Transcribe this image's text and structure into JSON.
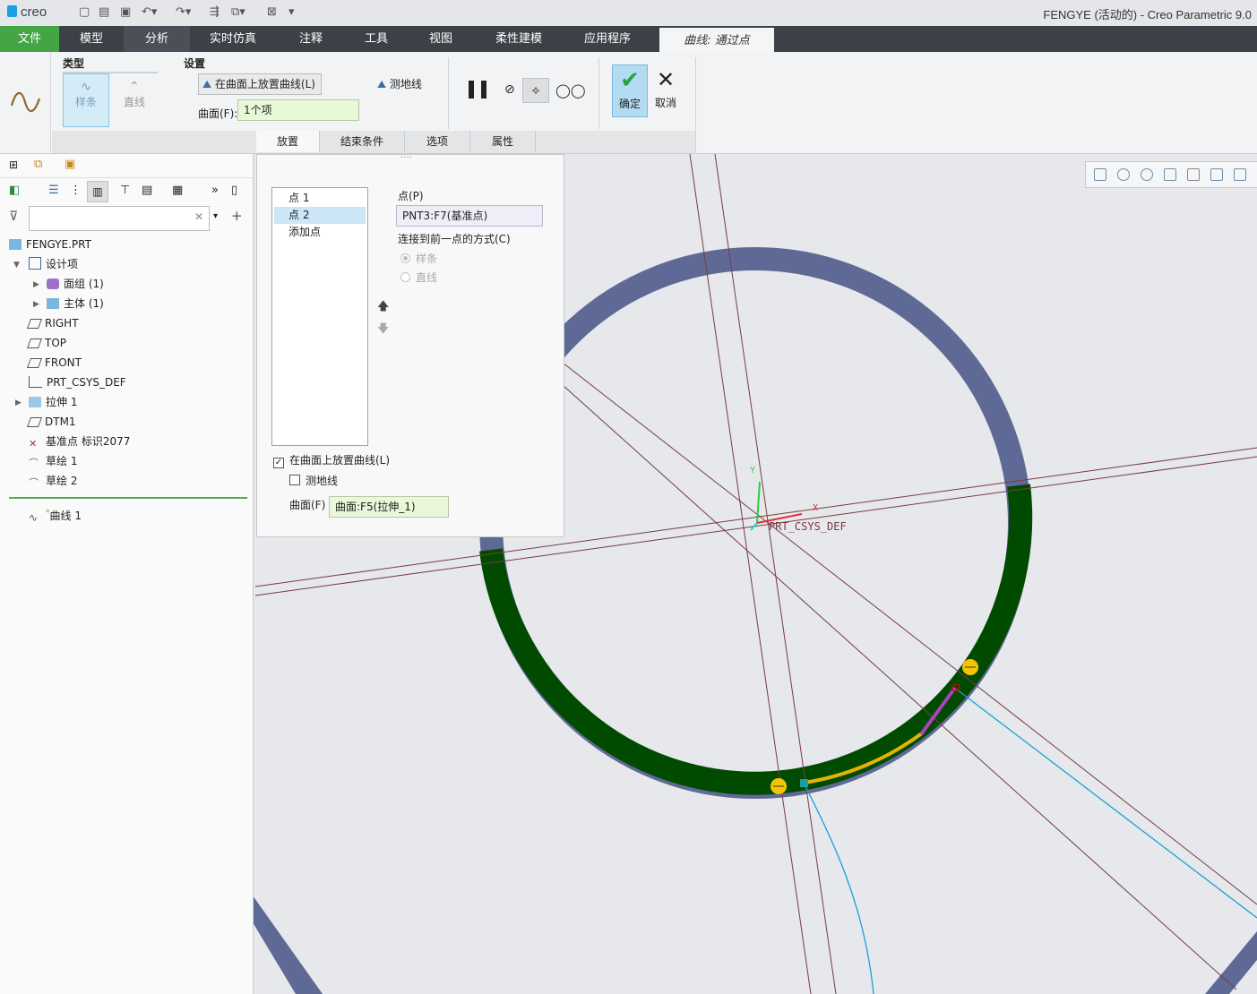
{
  "titlebar": {
    "logo": "creo",
    "window_title": "FENGYE (活动的) - Creo Parametric 9.0"
  },
  "menubar": {
    "items": [
      "文件",
      "模型",
      "分析",
      "实时仿真",
      "注释",
      "工具",
      "视图",
      "柔性建模",
      "应用程序"
    ],
    "context_tab": "曲线: 通过点"
  },
  "ribbon": {
    "type_group": "类型",
    "type_spline": "样条",
    "type_line": "直线",
    "settings_group": "设置",
    "place_on_surface_btn": "在曲面上放置曲线(L)",
    "geodesic_btn": "测地线",
    "surface_label": "曲面(F):",
    "surface_value": "1个项",
    "ok": "确定",
    "cancel": "取消",
    "tabs": [
      "放置",
      "结束条件",
      "选项",
      "属性"
    ]
  },
  "tree": {
    "root": "FENGYE.PRT",
    "items": [
      "设计项",
      "面组 (1)",
      "主体 (1)",
      "RIGHT",
      "TOP",
      "FRONT",
      "PRT_CSYS_DEF",
      "拉伸 1",
      "DTM1",
      "基准点 标识2077",
      "草绘 1",
      "草绘 2",
      "曲线 1"
    ],
    "new_marker": "*"
  },
  "placement": {
    "points": [
      "点 1",
      "点 2",
      "添加点"
    ],
    "point_label": "点(P)",
    "point_value": "PNT3:F7(基准点)",
    "connect_label": "连接到前一点的方式(C)",
    "radio_spline": "样条",
    "radio_line": "直线",
    "place_on_surface_check": "在曲面上放置曲线(L)",
    "geodesic_check": "测地线",
    "surface_label": "曲面(F)",
    "surface_value": "曲面:F5(拉伸_1)"
  },
  "viewport": {
    "csys_label": "PRT_CSYS_DEF",
    "axis_x": "X",
    "axis_y": "Y"
  },
  "colors": {
    "ring": "#5f6996",
    "highlight": "#004b00",
    "accent_green": "#44a545",
    "curve": "#1aa0d8"
  }
}
